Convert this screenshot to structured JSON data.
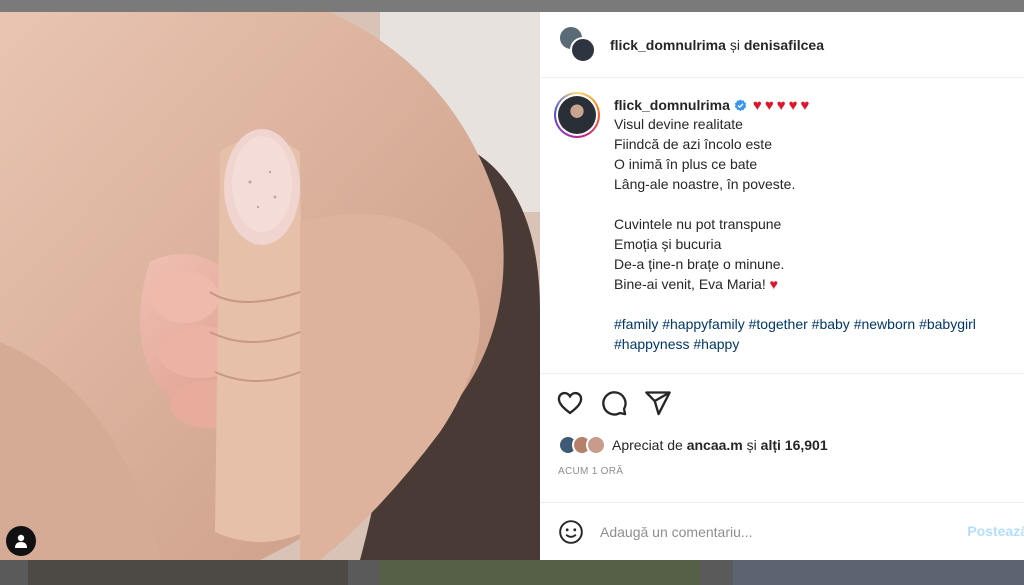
{
  "header": {
    "owner": "flick_domnulrima",
    "connector": "și",
    "collaborator": "denisafilcea"
  },
  "caption": {
    "username": "flick_domnulrima",
    "hearts": "♥♥♥♥♥",
    "lines": [
      "Visul devine realitate",
      "Fiindcă de azi încolo este",
      "O inimă în plus ce bate",
      "Lâng-ale noastre, în poveste.",
      "Cuvintele nu pot transpune",
      "Emoția și bucuria",
      "De-a ține-n brațe o minune.",
      "Bine-ai venit, Eva Maria!"
    ],
    "closing_heart": "♥",
    "hashtags_line1": "#family #happyfamily #together #baby #newborn #babygirl",
    "hashtags_line2": "#happyness #happy"
  },
  "actions": {
    "icons": [
      "heart-icon",
      "comment-icon",
      "share-icon"
    ]
  },
  "likes": {
    "prefix": "Apreciat de",
    "liker": "ancaa.m",
    "middle": "și",
    "others": "alți 16,901"
  },
  "timestamp": "ACUM 1 ORĂ",
  "comment": {
    "placeholder": "Adaugă un comentariu...",
    "post_label": "Postează"
  },
  "colors": {
    "heart": "#e0142b",
    "hashtag": "#00376b",
    "verified": "#3897f0"
  }
}
